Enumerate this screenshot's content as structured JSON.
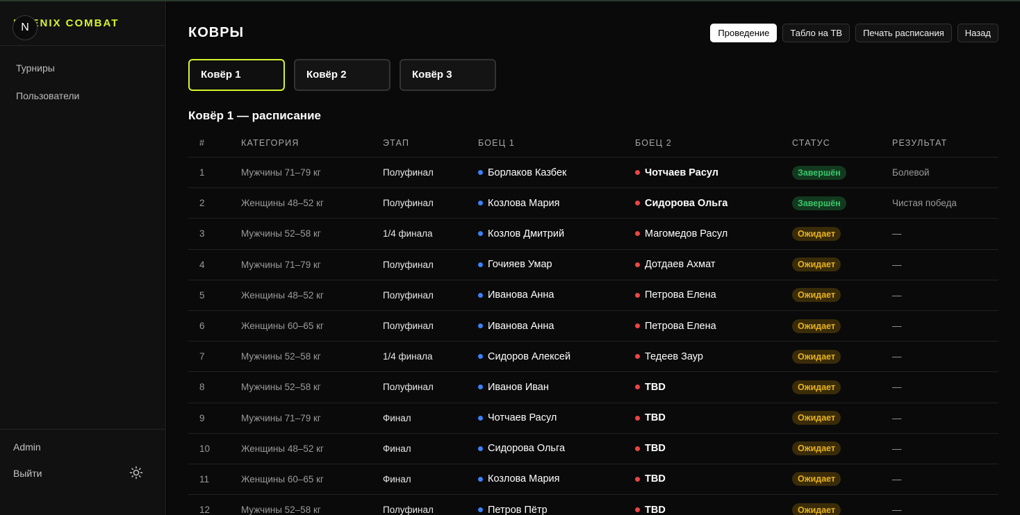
{
  "brand": {
    "name": "NOENIX COMBAT",
    "avatar_letter": "N",
    "accent": "#d4f52f"
  },
  "sidebar": {
    "items": [
      {
        "label": "Турниры"
      },
      {
        "label": "Пользователи"
      }
    ],
    "user": "Admin",
    "logout": "Выйти"
  },
  "header": {
    "title": "КОВРЫ",
    "actions": {
      "conduct": "Проведение",
      "tv": "Табло на ТВ",
      "print": "Печать расписания",
      "back": "Назад"
    }
  },
  "mats": [
    {
      "label": "Ковёр 1",
      "active": true
    },
    {
      "label": "Ковёр 2",
      "active": false
    },
    {
      "label": "Ковёр 3",
      "active": false
    }
  ],
  "schedule": {
    "title": "Ковёр 1 — расписание",
    "columns": {
      "num": "#",
      "category": "КАТЕГОРИЯ",
      "stage": "ЭТАП",
      "fighter1": "БОЕЦ 1",
      "fighter2": "БОЕЦ 2",
      "status": "СТАТУС",
      "result": "РЕЗУЛЬТАТ"
    },
    "rows": [
      {
        "num": "1",
        "category": "Мужчины 71–79 кг",
        "stage": "Полуфинал",
        "fighter1": "Борлаков Казбек",
        "fighter2": "Чотчаев Расул",
        "winner": 2,
        "status": "Завершён",
        "status_type": "done",
        "result": "Болевой"
      },
      {
        "num": "2",
        "category": "Женщины 48–52 кг",
        "stage": "Полуфинал",
        "fighter1": "Козлова Мария",
        "fighter2": "Сидорова Ольга",
        "winner": 2,
        "status": "Завершён",
        "status_type": "done",
        "result": "Чистая победа"
      },
      {
        "num": "3",
        "category": "Мужчины 52–58 кг",
        "stage": "1/4 финала",
        "fighter1": "Козлов Дмитрий",
        "fighter2": "Магомедов Расул",
        "winner": 0,
        "status": "Ожидает",
        "status_type": "wait",
        "result": "—"
      },
      {
        "num": "4",
        "category": "Мужчины 71–79 кг",
        "stage": "Полуфинал",
        "fighter1": "Гочияев Умар",
        "fighter2": "Дотдаев Ахмат",
        "winner": 0,
        "status": "Ожидает",
        "status_type": "wait",
        "result": "—"
      },
      {
        "num": "5",
        "category": "Женщины 48–52 кг",
        "stage": "Полуфинал",
        "fighter1": "Иванова Анна",
        "fighter2": "Петрова Елена",
        "winner": 0,
        "status": "Ожидает",
        "status_type": "wait",
        "result": "—"
      },
      {
        "num": "6",
        "category": "Женщины 60–65 кг",
        "stage": "Полуфинал",
        "fighter1": "Иванова Анна",
        "fighter2": "Петрова Елена",
        "winner": 0,
        "status": "Ожидает",
        "status_type": "wait",
        "result": "—"
      },
      {
        "num": "7",
        "category": "Мужчины 52–58 кг",
        "stage": "1/4 финала",
        "fighter1": "Сидоров Алексей",
        "fighter2": "Тедеев Заур",
        "winner": 0,
        "status": "Ожидает",
        "status_type": "wait",
        "result": "—"
      },
      {
        "num": "8",
        "category": "Мужчины 52–58 кг",
        "stage": "Полуфинал",
        "fighter1": "Иванов Иван",
        "fighter2": "TBD",
        "winner": 2,
        "status": "Ожидает",
        "status_type": "wait",
        "result": "—"
      },
      {
        "num": "9",
        "category": "Мужчины 71–79 кг",
        "stage": "Финал",
        "fighter1": "Чотчаев Расул",
        "fighter2": "TBD",
        "winner": 2,
        "status": "Ожидает",
        "status_type": "wait",
        "result": "—"
      },
      {
        "num": "10",
        "category": "Женщины 48–52 кг",
        "stage": "Финал",
        "fighter1": "Сидорова Ольга",
        "fighter2": "TBD",
        "winner": 2,
        "status": "Ожидает",
        "status_type": "wait",
        "result": "—"
      },
      {
        "num": "11",
        "category": "Женщины 60–65 кг",
        "stage": "Финал",
        "fighter1": "Козлова Мария",
        "fighter2": "TBD",
        "winner": 2,
        "status": "Ожидает",
        "status_type": "wait",
        "result": "—"
      },
      {
        "num": "12",
        "category": "Мужчины 52–58 кг",
        "stage": "Полуфинал",
        "fighter1": "Петров Пётр",
        "fighter2": "TBD",
        "winner": 2,
        "status": "Ожидает",
        "status_type": "wait",
        "result": "—"
      }
    ]
  },
  "colors": {
    "fighter1_dot": "#3b82f6",
    "fighter2_dot": "#ef4444",
    "done": "#3cc46a",
    "wait": "#e8b21f"
  }
}
